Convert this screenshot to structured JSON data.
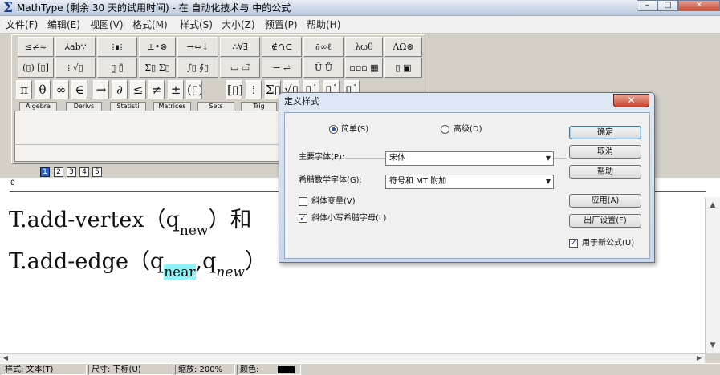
{
  "window": {
    "title": "MathType (剩余 30 天的试用时间) - 在 自动化技术与 中的公式",
    "controls": {
      "minimize": "–",
      "maximize": "□",
      "close": "✕"
    }
  },
  "menu": [
    "文件(F)",
    "编辑(E)",
    "视图(V)",
    "格式(M)",
    "样式(S)",
    "大小(Z)",
    "预置(P)",
    "帮助(H)"
  ],
  "palette": {
    "row1": [
      "≤≠≈",
      "⅄ab∵",
      "⁞∎⁞",
      "±•⊗",
      "→⇔↓",
      "∴∀∃",
      "∉∩⊂",
      "∂∞ℓ",
      "λωθ",
      "ΛΩ⊛"
    ],
    "row2": [
      "(▯) [▯]",
      "⁞ √▯",
      "▯̲ ▯̄",
      "Σ▯ Σ▯",
      "∫▯ ∮▯",
      "▭ ▭⃗",
      "⇀ ⇌",
      "Ũ Ů",
      "▫▫▫ ▦",
      "▯ ▣"
    ],
    "symbols": [
      "π",
      "θ",
      "∞",
      "∈",
      "→",
      "∂",
      "≤",
      "≠",
      "±",
      "(▯)",
      "[▯]",
      "⁞",
      "Σ▯",
      "√▯",
      "▯˙",
      "▯˙",
      "▯˙"
    ],
    "tabs": [
      "Algebra",
      "Derivs",
      "Statisti",
      "Matrices",
      "Sets",
      "Trig"
    ],
    "small_buttons": [
      "1",
      "2",
      "3",
      "4",
      "5"
    ]
  },
  "ruler": {
    "zero": "0"
  },
  "editor": {
    "line1": {
      "base": "T.add-vertex（q",
      "sub": "new",
      "tail": "）和"
    },
    "line2": {
      "base": "T.add-edge（q",
      "sub1": "near",
      "mid": ",q",
      "sub2": "new",
      "tail": "）"
    }
  },
  "status": {
    "style": "样式: 文本(T)",
    "size": "尺寸: 下标(U)",
    "zoom": "缩放: 200%",
    "color_label": "颜色:",
    "color_value": "#000000"
  },
  "dialog": {
    "title": "定义样式",
    "close": "✕",
    "simple_label": "简单(S)",
    "advanced_label": "高级(D)",
    "mode": "simple",
    "primary_font_label": "主要字体(P):",
    "primary_font_value": "宋体",
    "greek_font_label": "希腊数学字体(G):",
    "greek_font_value": "符号和 MT 附加",
    "italic_variable_label": "斜体变量(V)",
    "italic_variable_checked": false,
    "italic_greek_label": "斜体小写希腊字母(L)",
    "italic_greek_checked": true,
    "ok_label": "确定",
    "cancel_label": "取消",
    "help_label": "帮助",
    "apply_label": "应用(A)",
    "factory_label": "出厂设置(F)",
    "new_eq_label": "用于新公式(U)",
    "new_eq_checked": true
  }
}
